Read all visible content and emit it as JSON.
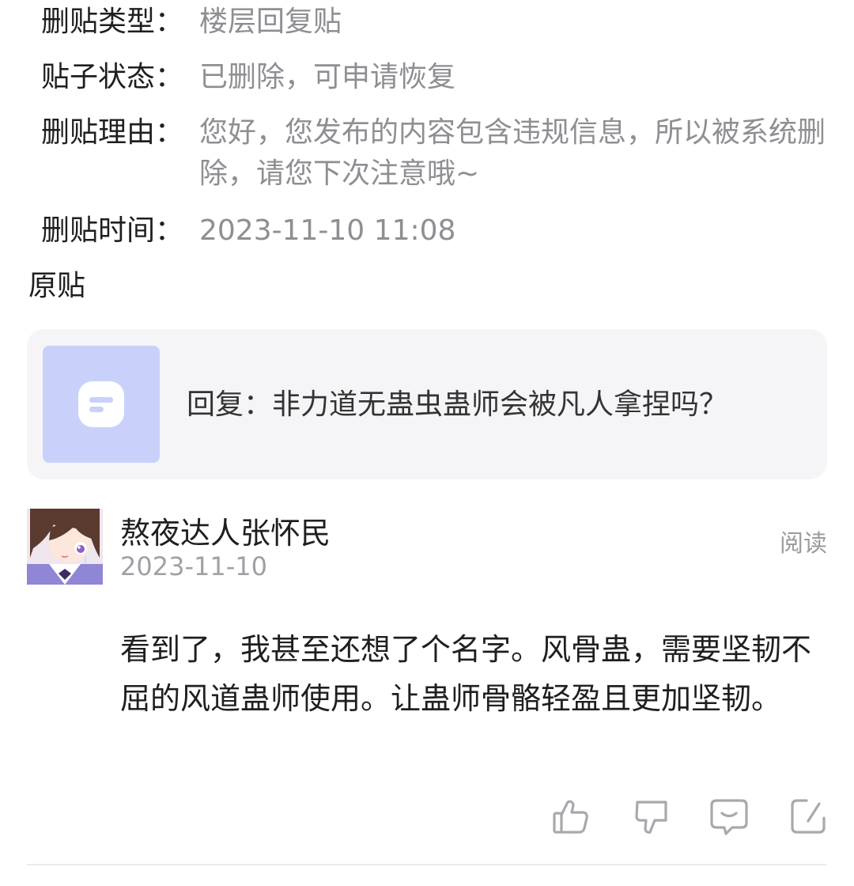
{
  "deletion_info": {
    "type_label": "删贴类型：",
    "type_value": "楼层回复贴",
    "status_label": "贴子状态：",
    "status_value": "已删除，可申请恢复",
    "reason_label": "删贴理由：",
    "reason_value": "您好，您发布的内容包含违规信息，所以被系统删除，请您下次注意哦~",
    "time_label": "删贴时间：",
    "time_value": "2023-11-10 11:08"
  },
  "original_section": {
    "title": "原贴",
    "card_text": "回复：非力道无蛊虫蛊师会被凡人拿捏吗？",
    "thumb_icon": "chat-bubble-icon"
  },
  "reply": {
    "username": "熬夜达人张怀民",
    "date": "2023-11-10",
    "read_label": "阅读",
    "content": " 看到了，我甚至还想了个名字。风骨蛊，需要坚韧不屈的风道蛊师使用。让蛊师骨骼轻盈且更加坚韧。"
  },
  "actions": [
    "like-icon",
    "dislike-icon",
    "comment-icon",
    "edit-icon"
  ],
  "colors": {
    "text_primary": "#1f1f1f",
    "text_secondary": "#8e8e93",
    "card_bg": "#f5f5f8",
    "thumb_bg": "#c9d1fb",
    "icon_gray": "#a8a8ae"
  }
}
